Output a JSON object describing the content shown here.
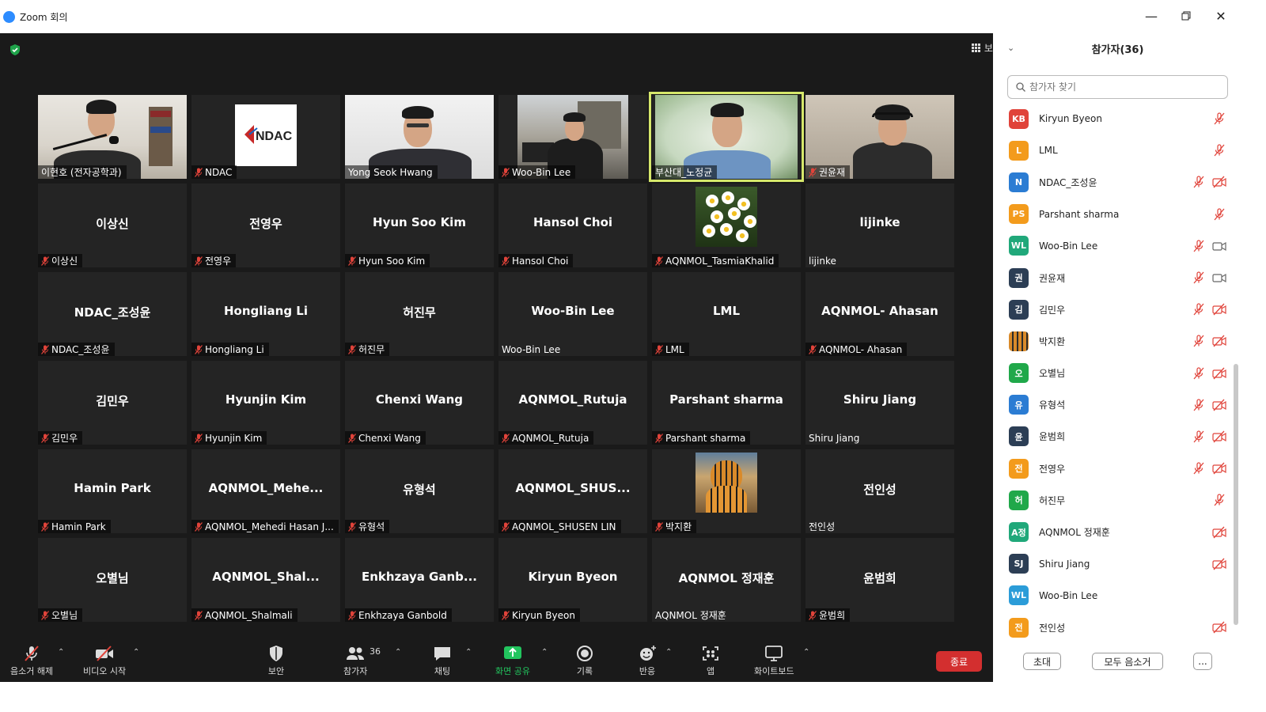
{
  "window": {
    "title": "Zoom 회의"
  },
  "meeting": {
    "view_label": "보기",
    "tiles": [
      {
        "center": "",
        "label": "이현호 (전자공학과)",
        "muted": false,
        "video": "person1"
      },
      {
        "center": "",
        "label": "NDAC",
        "muted": true,
        "video": "ndac"
      },
      {
        "center": "",
        "label": "Yong Seok Hwang",
        "muted": false,
        "video": "person3"
      },
      {
        "center": "",
        "label": "Woo-Bin Lee",
        "muted": true,
        "video": "person4"
      },
      {
        "center": "",
        "label": "부산대_노정균",
        "muted": false,
        "video": "person5",
        "speaking": true
      },
      {
        "center": "",
        "label": "권윤재",
        "muted": true,
        "video": "person6"
      },
      {
        "center": "이상신",
        "label": "이상신",
        "muted": true
      },
      {
        "center": "전영우",
        "label": "전영우",
        "muted": true
      },
      {
        "center": "Hyun Soo Kim",
        "label": "Hyun Soo Kim",
        "muted": true
      },
      {
        "center": "Hansol Choi",
        "label": "Hansol Choi",
        "muted": true
      },
      {
        "center": "",
        "label": "AQNMOL_TasmiaKhalid",
        "muted": true,
        "video": "flowers"
      },
      {
        "center": "lijinke",
        "label": "lijinke",
        "muted": false
      },
      {
        "center": "NDAC_조성윤",
        "label": "NDAC_조성윤",
        "muted": true
      },
      {
        "center": "Hongliang Li",
        "label": "Hongliang Li",
        "muted": true
      },
      {
        "center": "허진무",
        "label": "허진무",
        "muted": true
      },
      {
        "center": "Woo-Bin Lee",
        "label": "Woo-Bin Lee",
        "muted": false
      },
      {
        "center": "LML",
        "label": "LML",
        "muted": true
      },
      {
        "center": "AQNMOL- Ahasan",
        "label": "AQNMOL- Ahasan",
        "muted": true
      },
      {
        "center": "김민우",
        "label": "김민우",
        "muted": true
      },
      {
        "center": "Hyunjin Kim",
        "label": "Hyunjin Kim",
        "muted": true
      },
      {
        "center": "Chenxi Wang",
        "label": "Chenxi Wang",
        "muted": true
      },
      {
        "center": "AQNMOL_Rutuja",
        "label": "AQNMOL_Rutuja",
        "muted": true
      },
      {
        "center": "Parshant sharma",
        "label": "Parshant sharma",
        "muted": true
      },
      {
        "center": "Shiru Jiang",
        "label": "Shiru Jiang",
        "muted": false
      },
      {
        "center": "Hamin Park",
        "label": "Hamin Park",
        "muted": true
      },
      {
        "center": "AQNMOL_Mehe...",
        "label": "AQNMOL_Mehedi Hasan J...",
        "muted": true
      },
      {
        "center": "유형석",
        "label": "유형석",
        "muted": true
      },
      {
        "center": "AQNMOL_SHUS...",
        "label": "AQNMOL_SHUSEN LIN",
        "muted": true
      },
      {
        "center": "",
        "label": "박지환",
        "muted": true,
        "video": "tiger"
      },
      {
        "center": "전인성",
        "label": "전인성",
        "muted": false
      },
      {
        "center": "오별님",
        "label": "오별님",
        "muted": true
      },
      {
        "center": "AQNMOL_Shal...",
        "label": "AQNMOL_Shalmali",
        "muted": true
      },
      {
        "center": "Enkhzaya  Ganb...",
        "label": "Enkhzaya Ganbold",
        "muted": true
      },
      {
        "center": "Kiryun Byeon",
        "label": "Kiryun Byeon",
        "muted": true
      },
      {
        "center": "AQNMOL 정재훈",
        "label": "AQNMOL 정재훈",
        "muted": false
      },
      {
        "center": "윤범희",
        "label": "윤범희",
        "muted": true
      }
    ]
  },
  "toolbar": {
    "unmute": "음소거 해제",
    "start_video": "비디오 시작",
    "security": "보안",
    "participants": "참가자",
    "participants_count": "36",
    "chat": "채팅",
    "share_screen": "화면 공유",
    "record": "기록",
    "reactions": "반응",
    "apps": "앱",
    "whiteboard": "화이트보드",
    "end": "종료"
  },
  "panel": {
    "title": "참가자(36)",
    "search_placeholder": "참가자 찾기",
    "participants": [
      {
        "initials": "KB",
        "name": "Kiryun Byeon",
        "color": "#e0433a",
        "mic_off": true,
        "video": "none"
      },
      {
        "initials": "L",
        "name": "LML",
        "color": "#f39b1c",
        "mic_off": true,
        "video": "none"
      },
      {
        "initials": "N",
        "name": "NDAC_조성윤",
        "color": "#2b7cd3",
        "mic_off": true,
        "video": "off"
      },
      {
        "initials": "PS",
        "name": "Parshant sharma",
        "color": "#f39b1c",
        "mic_off": true,
        "video": "none"
      },
      {
        "initials": "WL",
        "name": "Woo-Bin Lee",
        "color": "#20a87a",
        "mic_off": true,
        "video": "on"
      },
      {
        "initials": "권",
        "name": "권윤재",
        "color": "#2c3e55",
        "mic_off": true,
        "video": "on"
      },
      {
        "initials": "김",
        "name": "김민우",
        "color": "#2c3e55",
        "mic_off": true,
        "video": "off"
      },
      {
        "initials": "",
        "name": "박지환",
        "color": "#a86a3c",
        "mic_off": true,
        "video": "off",
        "photo": true
      },
      {
        "initials": "오",
        "name": "오별님",
        "color": "#20a84a",
        "mic_off": true,
        "video": "off"
      },
      {
        "initials": "유",
        "name": "유형석",
        "color": "#2b7cd3",
        "mic_off": true,
        "video": "off"
      },
      {
        "initials": "윤",
        "name": "윤범희",
        "color": "#2c3e55",
        "mic_off": true,
        "video": "off"
      },
      {
        "initials": "전",
        "name": "전영우",
        "color": "#f39b1c",
        "mic_off": true,
        "video": "off"
      },
      {
        "initials": "허",
        "name": "허진무",
        "color": "#20a84a",
        "mic_off": true,
        "video": "none"
      },
      {
        "initials": "A정",
        "name": "AQNMOL 정재훈",
        "color": "#20a87a",
        "mic_off": false,
        "video": "off"
      },
      {
        "initials": "SJ",
        "name": "Shiru Jiang",
        "color": "#2c3e55",
        "mic_off": false,
        "video": "off"
      },
      {
        "initials": "WL",
        "name": "Woo-Bin Lee",
        "color": "#2b9cd8",
        "mic_off": false,
        "video": "none"
      },
      {
        "initials": "전",
        "name": "전인성",
        "color": "#f39b1c",
        "mic_off": false,
        "video": "off"
      }
    ],
    "invite": "초대",
    "mute_all": "모두 음소거",
    "more": "..."
  },
  "colors": {
    "accent": "#2d8cff",
    "end": "#d32f2f",
    "share": "#22c55e",
    "muted": "#e0433a"
  }
}
